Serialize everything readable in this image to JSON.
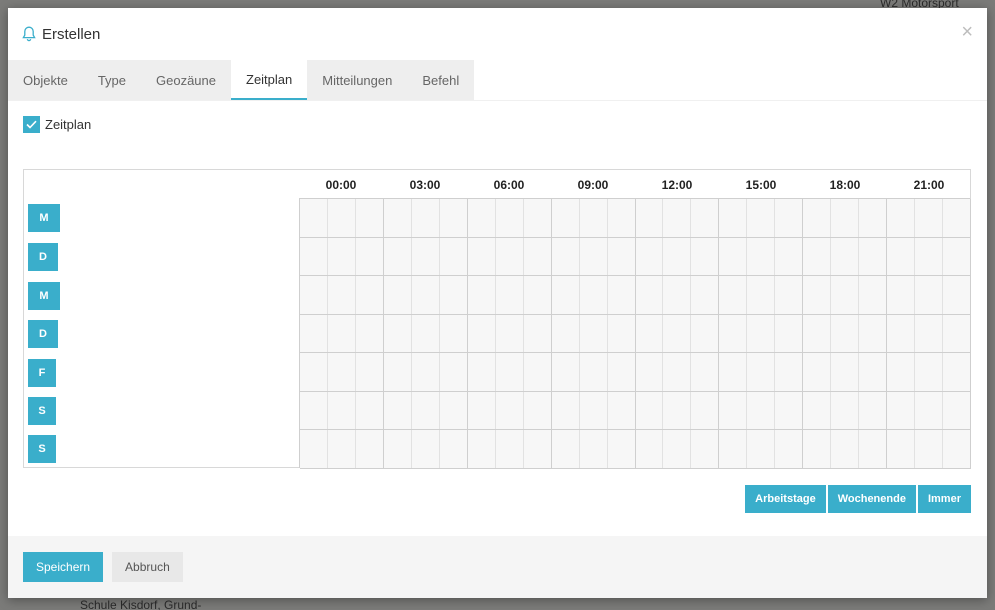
{
  "modal": {
    "title": "Erstellen",
    "close_glyph": "×",
    "bell_icon": "bell-icon",
    "accent_color": "#3aaecb"
  },
  "tabs": [
    {
      "label": "Objekte",
      "active": false
    },
    {
      "label": "Type",
      "active": false
    },
    {
      "label": "Geozäune",
      "active": false
    },
    {
      "label": "Zeitplan",
      "active": true
    },
    {
      "label": "Mitteilungen",
      "active": false
    },
    {
      "label": "Befehl",
      "active": false
    }
  ],
  "schedule": {
    "enabled_label": "Zeitplan",
    "enabled": true,
    "hours": [
      "00:00",
      "03:00",
      "06:00",
      "09:00",
      "12:00",
      "15:00",
      "18:00",
      "21:00"
    ],
    "days": [
      "M",
      "D",
      "M",
      "D",
      "F",
      "S",
      "S"
    ]
  },
  "presets": {
    "workdays": "Arbeitstage",
    "weekend": "Wochenende",
    "always": "Immer"
  },
  "footer": {
    "save": "Speichern",
    "cancel": "Abbruch"
  },
  "background": {
    "map_text_1": "W2 Motorsport",
    "map_text_2": "Schule Kisdorf, Grund-"
  }
}
